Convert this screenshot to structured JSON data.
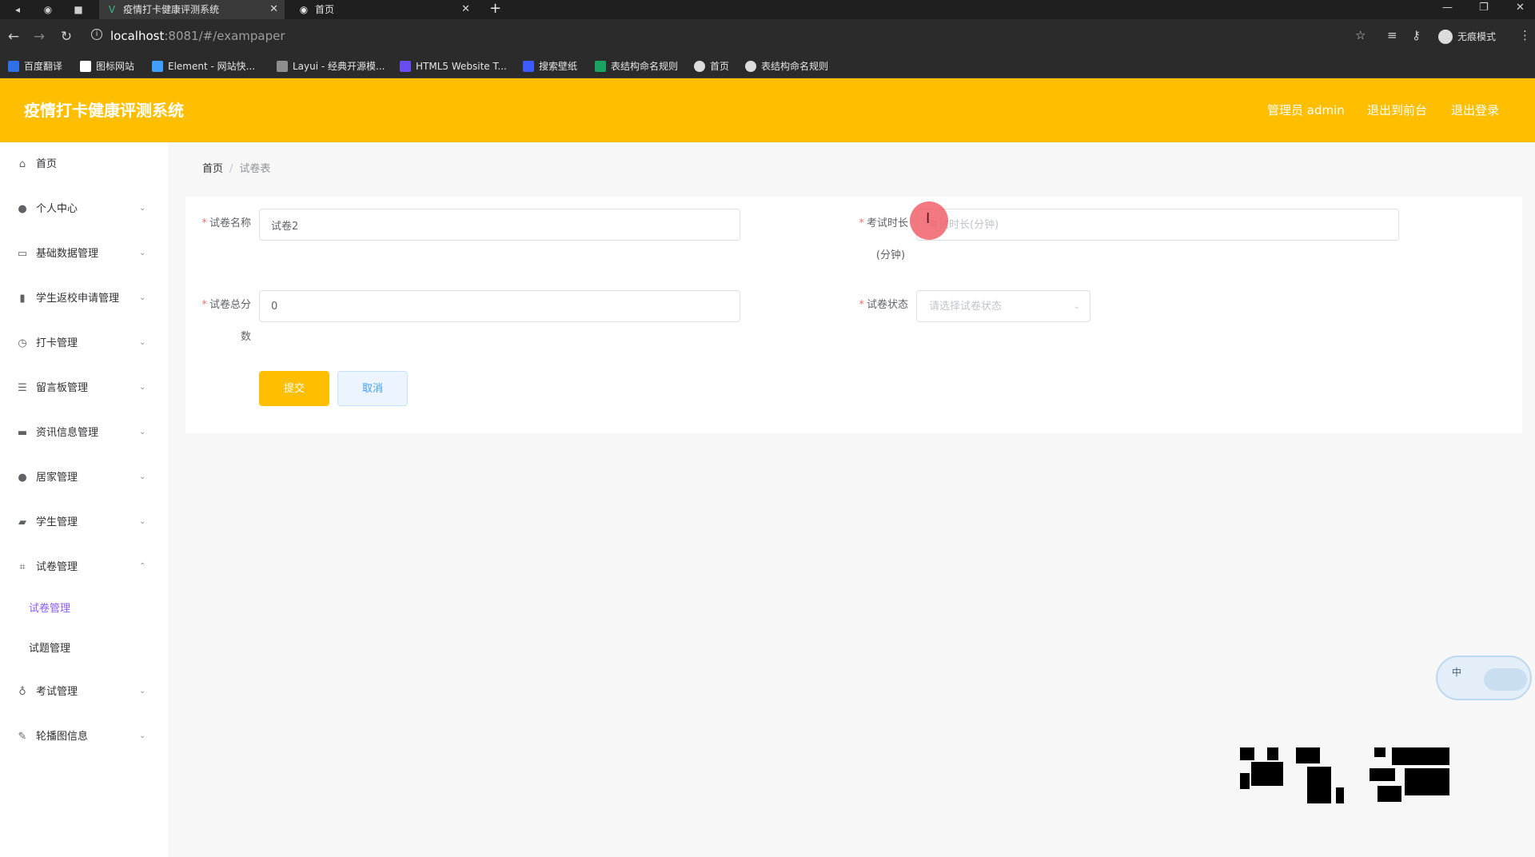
{
  "browser": {
    "tabs": [
      {
        "title": "疫情打卡健康评测系统",
        "favicon": "vue-logo-icon",
        "active": true
      },
      {
        "title": "首页",
        "favicon": "globe-icon",
        "active": false
      }
    ],
    "url": {
      "host": "localhost",
      "rest": ":8081/#/exampaper"
    },
    "incognito_label": "无痕模式",
    "bookmarks": [
      {
        "label": "百度翻译",
        "color": "#2f6fe8"
      },
      {
        "label": "图标网站",
        "color": "#ffffff"
      },
      {
        "label": "Element - 网站快...",
        "color": "#409eff"
      },
      {
        "label": "Layui - 经典开源模...",
        "color": "#8e8e8e"
      },
      {
        "label": "HTML5 Website T...",
        "color": "#6a4cf0"
      },
      {
        "label": "搜索壁纸",
        "color": "#3d5afe"
      },
      {
        "label": "表结构命名规则",
        "color": "#1aa260"
      },
      {
        "label": "首页",
        "color": "#dcdcdc"
      },
      {
        "label": "表结构命名规则",
        "color": "#dcdcdc"
      }
    ]
  },
  "header": {
    "title": "疫情打卡健康评测系统",
    "user": "管理员 admin",
    "to_front": "退出到前台",
    "logout": "退出登录",
    "color": "#ffbf00"
  },
  "sidebar": {
    "items": [
      {
        "label": "首页",
        "icon": "home-icon"
      },
      {
        "label": "个人中心",
        "icon": "user-icon"
      },
      {
        "label": "基础数据管理",
        "icon": "card-icon"
      },
      {
        "label": "学生返校申请管理",
        "icon": "bar-chart-icon"
      },
      {
        "label": "打卡管理",
        "icon": "clock-icon"
      },
      {
        "label": "留言板管理",
        "icon": "sliders-icon"
      },
      {
        "label": "资讯信息管理",
        "icon": "monitor-icon"
      },
      {
        "label": "居家管理",
        "icon": "user-icon"
      },
      {
        "label": "学生管理",
        "icon": "briefcase-icon"
      },
      {
        "label": "试卷管理",
        "icon": "crop-icon"
      },
      {
        "label": "考试管理",
        "icon": "microphone-icon"
      },
      {
        "label": "轮播图信息",
        "icon": "edit-icon"
      }
    ],
    "exam_submenu": [
      "试卷管理",
      "试题管理"
    ],
    "active_color": "#8a5cf6"
  },
  "breadcrumb": {
    "home": "首页",
    "current": "试卷表"
  },
  "form": {
    "name_label": "试卷名称",
    "name_value": "试卷2",
    "duration_label": "考试时长",
    "duration_unit": "(分钟)",
    "duration_placeholder": "考试时长(分钟)",
    "total_label": "试卷总分",
    "total_label_wrap": "数",
    "total_value": "0",
    "status_label": "试卷状态",
    "status_placeholder": "请选择试卷状态",
    "submit": "提交",
    "cancel": "取消"
  },
  "ime": {
    "mode": "中"
  }
}
